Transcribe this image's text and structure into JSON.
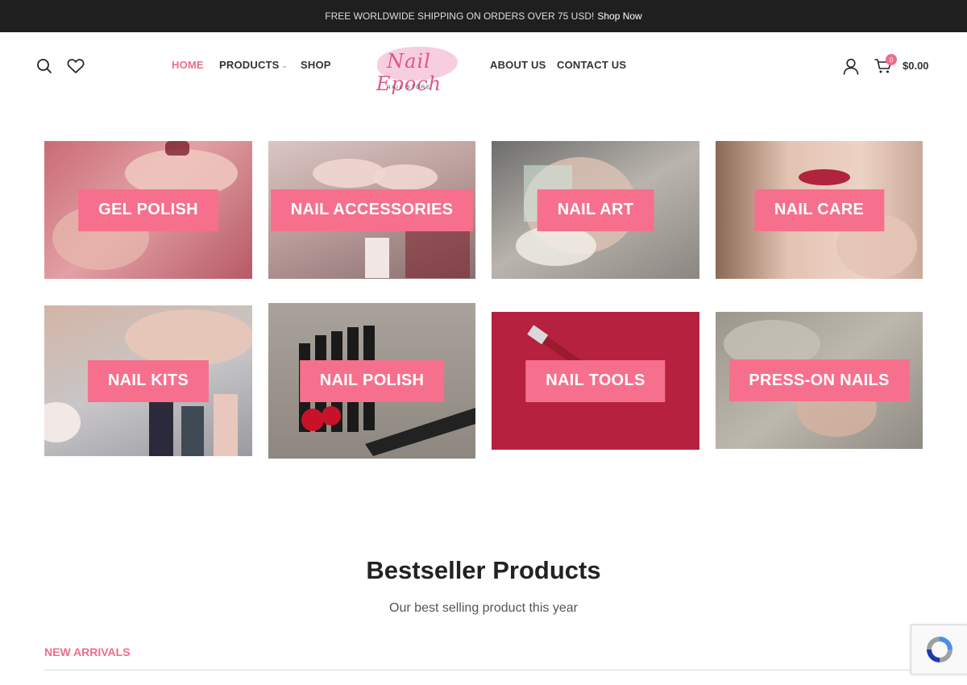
{
  "topbar": {
    "text": "FREE WORLDWIDE SHIPPING ON ORDERS OVER 75 USD!",
    "link": "Shop Now"
  },
  "header": {
    "nav_left": [
      {
        "label": "HOME",
        "active": true
      },
      {
        "label": "PRODUCTS",
        "active": false,
        "has_dropdown": true
      },
      {
        "label": "SHOP",
        "active": false
      }
    ],
    "nav_right": [
      {
        "label": "ABOUT US"
      },
      {
        "label": "CONTACT US"
      }
    ],
    "logo": {
      "script": "Nail Epoch",
      "sub": "NAIL STORE"
    },
    "cart": {
      "count": "0",
      "total": "$0.00"
    },
    "icons": [
      "search-icon",
      "heart-icon",
      "user-icon",
      "cart-icon"
    ]
  },
  "categories": [
    {
      "label": "GEL POLISH"
    },
    {
      "label": "NAIL ACCESSORIES"
    },
    {
      "label": "NAIL ART"
    },
    {
      "label": "NAIL CARE"
    },
    {
      "label": "NAIL KITS"
    },
    {
      "label": "NAIL POLISH"
    },
    {
      "label": "NAIL TOOLS"
    },
    {
      "label": "PRESS-ON NAILS"
    }
  ],
  "bestseller": {
    "title": "Bestseller Products",
    "subtitle": "Our best selling product this year",
    "tabs": [
      {
        "label": "NEW ARRIVALS",
        "active": true
      }
    ]
  },
  "colors": {
    "accent": "#f06b8a",
    "label_bg": "#f6708d",
    "topbar_bg": "#1f1f1f"
  }
}
